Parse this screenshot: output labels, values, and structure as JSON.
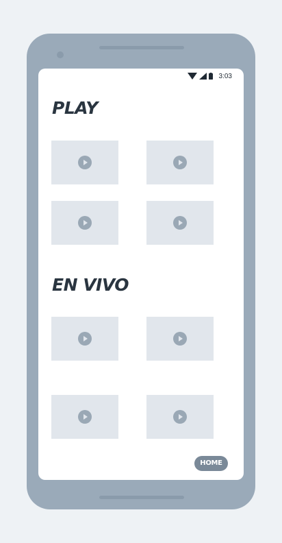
{
  "status_bar": {
    "time": "3:03",
    "icons": [
      "wifi-icon",
      "signal-icon",
      "battery-icon"
    ]
  },
  "sections": [
    {
      "title": "PLAY",
      "videos": [
        {
          "icon": "play-icon"
        },
        {
          "icon": "play-icon"
        },
        {
          "icon": "play-icon"
        },
        {
          "icon": "play-icon"
        }
      ]
    },
    {
      "title": "EN VIVO",
      "videos": [
        {
          "icon": "play-icon"
        },
        {
          "icon": "play-icon"
        },
        {
          "icon": "play-icon"
        },
        {
          "icon": "play-icon"
        }
      ]
    }
  ],
  "home_button": {
    "label": "HOME"
  },
  "colors": {
    "device": "#9aaab9",
    "background": "#eef2f5",
    "screen": "#ffffff",
    "thumbnail": "#e1e6ec",
    "play_icon": "#9aa8b5",
    "title_text": "#2a3540",
    "home_button": "#7a8998"
  }
}
